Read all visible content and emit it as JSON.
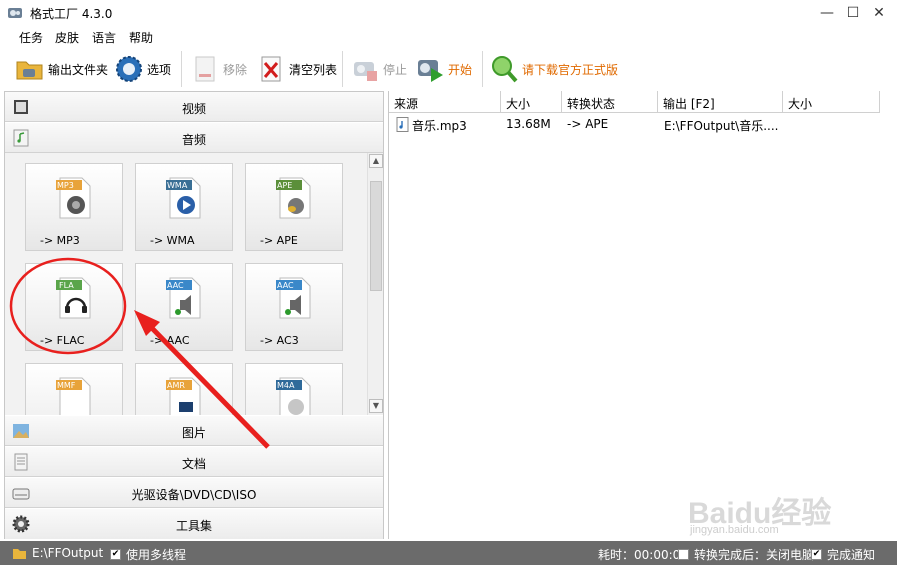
{
  "window": {
    "title": "格式工厂 4.3.0",
    "minimize": "—",
    "maximize": "☐",
    "close": "✕"
  },
  "menu": [
    "任务",
    "皮肤",
    "语言",
    "帮助"
  ],
  "toolbar": {
    "output_folder": "输出文件夹",
    "options": "选项",
    "remove": "移除",
    "clear_list": "清空列表",
    "stop": "停止",
    "start": "开始",
    "download": "请下载官方正式版"
  },
  "categories": {
    "video": "视频",
    "audio": "音频",
    "picture": "图片",
    "document": "文档",
    "rom": "光驱设备\\DVD\\CD\\ISO",
    "tools": "工具集"
  },
  "tiles": [
    {
      "badge": "MP3",
      "label": "-> MP3",
      "color": "#e8a33a"
    },
    {
      "badge": "WMA",
      "label": "-> WMA",
      "color": "#3a6f95"
    },
    {
      "badge": "APE",
      "label": "-> APE",
      "color": "#5b8f3a"
    },
    {
      "badge": "FLA",
      "label": "-> FLAC",
      "color": "#5aa54a"
    },
    {
      "badge": "AAC",
      "label": "-> AAC",
      "color": "#3a88c9"
    },
    {
      "badge": "AAC",
      "label": "-> AC3",
      "color": "#3a88c9"
    },
    {
      "badge": "MMF",
      "label": "",
      "color": "#e8a33a"
    },
    {
      "badge": "AMR",
      "label": "",
      "color": "#e8a33a"
    },
    {
      "badge": "M4A",
      "label": "",
      "color": "#2f6a9a"
    }
  ],
  "list": {
    "headers": [
      "来源",
      "大小",
      "转换状态",
      "输出 [F2]",
      "大小"
    ],
    "rows": [
      {
        "source": "音乐.mp3",
        "size": "13.68M",
        "status": "-> APE",
        "output": "E:\\FFOutput\\音乐....",
        "out_size": ""
      }
    ]
  },
  "status": {
    "output_path": "E:\\FFOutput",
    "multithread": "使用多线程",
    "elapsed": "耗时：00:00:00",
    "after_convert": "转换完成后：关闭电脑",
    "notify": "完成通知"
  },
  "watermark": {
    "text": "Baidu经验",
    "url": "jingyan.baidu.com"
  },
  "colors": {
    "accent_orange": "#e06a00",
    "annotation_red": "#e8201e",
    "statusbar": "#6b6b6b"
  }
}
